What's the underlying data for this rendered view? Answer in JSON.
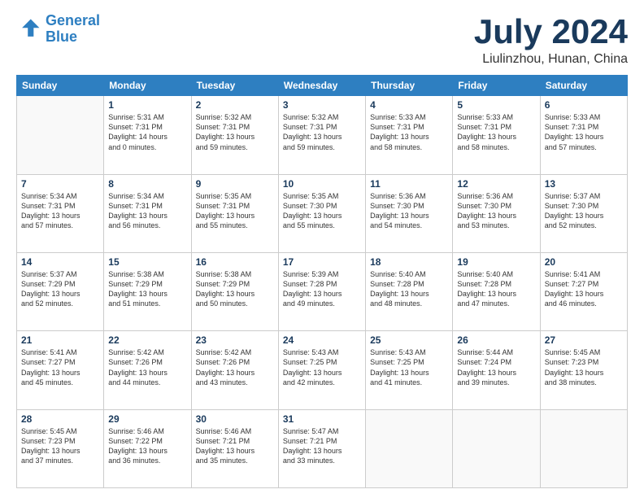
{
  "header": {
    "logo_line1": "General",
    "logo_line2": "Blue",
    "month_title": "July 2024",
    "location": "Liulinzhou, Hunan, China"
  },
  "days_of_week": [
    "Sunday",
    "Monday",
    "Tuesday",
    "Wednesday",
    "Thursday",
    "Friday",
    "Saturday"
  ],
  "weeks": [
    [
      {
        "day": "",
        "info": ""
      },
      {
        "day": "1",
        "info": "Sunrise: 5:31 AM\nSunset: 7:31 PM\nDaylight: 14 hours\nand 0 minutes."
      },
      {
        "day": "2",
        "info": "Sunrise: 5:32 AM\nSunset: 7:31 PM\nDaylight: 13 hours\nand 59 minutes."
      },
      {
        "day": "3",
        "info": "Sunrise: 5:32 AM\nSunset: 7:31 PM\nDaylight: 13 hours\nand 59 minutes."
      },
      {
        "day": "4",
        "info": "Sunrise: 5:33 AM\nSunset: 7:31 PM\nDaylight: 13 hours\nand 58 minutes."
      },
      {
        "day": "5",
        "info": "Sunrise: 5:33 AM\nSunset: 7:31 PM\nDaylight: 13 hours\nand 58 minutes."
      },
      {
        "day": "6",
        "info": "Sunrise: 5:33 AM\nSunset: 7:31 PM\nDaylight: 13 hours\nand 57 minutes."
      }
    ],
    [
      {
        "day": "7",
        "info": "Sunrise: 5:34 AM\nSunset: 7:31 PM\nDaylight: 13 hours\nand 57 minutes."
      },
      {
        "day": "8",
        "info": "Sunrise: 5:34 AM\nSunset: 7:31 PM\nDaylight: 13 hours\nand 56 minutes."
      },
      {
        "day": "9",
        "info": "Sunrise: 5:35 AM\nSunset: 7:31 PM\nDaylight: 13 hours\nand 55 minutes."
      },
      {
        "day": "10",
        "info": "Sunrise: 5:35 AM\nSunset: 7:30 PM\nDaylight: 13 hours\nand 55 minutes."
      },
      {
        "day": "11",
        "info": "Sunrise: 5:36 AM\nSunset: 7:30 PM\nDaylight: 13 hours\nand 54 minutes."
      },
      {
        "day": "12",
        "info": "Sunrise: 5:36 AM\nSunset: 7:30 PM\nDaylight: 13 hours\nand 53 minutes."
      },
      {
        "day": "13",
        "info": "Sunrise: 5:37 AM\nSunset: 7:30 PM\nDaylight: 13 hours\nand 52 minutes."
      }
    ],
    [
      {
        "day": "14",
        "info": "Sunrise: 5:37 AM\nSunset: 7:29 PM\nDaylight: 13 hours\nand 52 minutes."
      },
      {
        "day": "15",
        "info": "Sunrise: 5:38 AM\nSunset: 7:29 PM\nDaylight: 13 hours\nand 51 minutes."
      },
      {
        "day": "16",
        "info": "Sunrise: 5:38 AM\nSunset: 7:29 PM\nDaylight: 13 hours\nand 50 minutes."
      },
      {
        "day": "17",
        "info": "Sunrise: 5:39 AM\nSunset: 7:28 PM\nDaylight: 13 hours\nand 49 minutes."
      },
      {
        "day": "18",
        "info": "Sunrise: 5:40 AM\nSunset: 7:28 PM\nDaylight: 13 hours\nand 48 minutes."
      },
      {
        "day": "19",
        "info": "Sunrise: 5:40 AM\nSunset: 7:28 PM\nDaylight: 13 hours\nand 47 minutes."
      },
      {
        "day": "20",
        "info": "Sunrise: 5:41 AM\nSunset: 7:27 PM\nDaylight: 13 hours\nand 46 minutes."
      }
    ],
    [
      {
        "day": "21",
        "info": "Sunrise: 5:41 AM\nSunset: 7:27 PM\nDaylight: 13 hours\nand 45 minutes."
      },
      {
        "day": "22",
        "info": "Sunrise: 5:42 AM\nSunset: 7:26 PM\nDaylight: 13 hours\nand 44 minutes."
      },
      {
        "day": "23",
        "info": "Sunrise: 5:42 AM\nSunset: 7:26 PM\nDaylight: 13 hours\nand 43 minutes."
      },
      {
        "day": "24",
        "info": "Sunrise: 5:43 AM\nSunset: 7:25 PM\nDaylight: 13 hours\nand 42 minutes."
      },
      {
        "day": "25",
        "info": "Sunrise: 5:43 AM\nSunset: 7:25 PM\nDaylight: 13 hours\nand 41 minutes."
      },
      {
        "day": "26",
        "info": "Sunrise: 5:44 AM\nSunset: 7:24 PM\nDaylight: 13 hours\nand 39 minutes."
      },
      {
        "day": "27",
        "info": "Sunrise: 5:45 AM\nSunset: 7:23 PM\nDaylight: 13 hours\nand 38 minutes."
      }
    ],
    [
      {
        "day": "28",
        "info": "Sunrise: 5:45 AM\nSunset: 7:23 PM\nDaylight: 13 hours\nand 37 minutes."
      },
      {
        "day": "29",
        "info": "Sunrise: 5:46 AM\nSunset: 7:22 PM\nDaylight: 13 hours\nand 36 minutes."
      },
      {
        "day": "30",
        "info": "Sunrise: 5:46 AM\nSunset: 7:21 PM\nDaylight: 13 hours\nand 35 minutes."
      },
      {
        "day": "31",
        "info": "Sunrise: 5:47 AM\nSunset: 7:21 PM\nDaylight: 13 hours\nand 33 minutes."
      },
      {
        "day": "",
        "info": ""
      },
      {
        "day": "",
        "info": ""
      },
      {
        "day": "",
        "info": ""
      }
    ]
  ]
}
